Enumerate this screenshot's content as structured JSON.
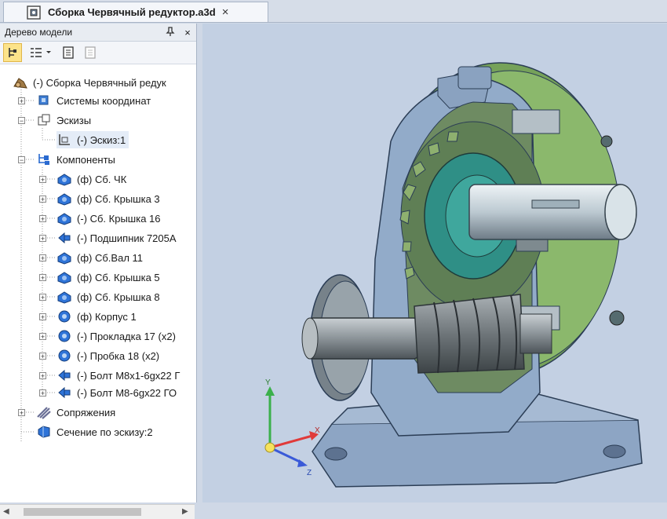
{
  "document_tab": {
    "title": "Сборка Червячный редуктор.a3d",
    "close": "×"
  },
  "model_tree_panel": {
    "title": "Дерево модели",
    "pin": "⌕",
    "close": "×",
    "items": [
      {
        "label": "(-) Сборка Червячный редук",
        "icon": "assembly-icon"
      },
      {
        "label": "Системы координат",
        "icon": "coordinate-systems-icon"
      },
      {
        "label": "Эскизы",
        "icon": "sketches-icon"
      },
      {
        "label": "(-) Эскиз:1",
        "icon": "sketch-icon"
      },
      {
        "label": "Компоненты",
        "icon": "components-icon"
      },
      {
        "label": "(ф) Сб. ЧК",
        "icon": "subassembly-icon"
      },
      {
        "label": "(ф) Сб. Крышка 3",
        "icon": "subassembly-icon"
      },
      {
        "label": "(-) Сб. Крышка 16",
        "icon": "subassembly-icon"
      },
      {
        "label": "(-) Подшипник 7205А",
        "icon": "standard-part-icon"
      },
      {
        "label": "(ф) Сб.Вал 11",
        "icon": "subassembly-icon"
      },
      {
        "label": "(ф) Сб. Крышка 5",
        "icon": "subassembly-icon"
      },
      {
        "label": "(ф) Сб. Крышка 8",
        "icon": "subassembly-icon"
      },
      {
        "label": "(ф) Корпус 1",
        "icon": "part-icon"
      },
      {
        "label": "(-) Прокладка 17 (x2)",
        "icon": "part-icon"
      },
      {
        "label": "(-) Пробка 18 (x2)",
        "icon": "part-icon"
      },
      {
        "label": "(-) Болт М8x1-6gx22 Г",
        "icon": "standard-part-icon"
      },
      {
        "label": "(-) Болт М8-6gx22 ГО",
        "icon": "standard-part-icon"
      },
      {
        "label": "Сопряжения",
        "icon": "mates-icon"
      },
      {
        "label": "Сечение по эскизу:2",
        "icon": "section-icon"
      }
    ]
  },
  "viewport": {
    "triad": {
      "x": "X",
      "y": "Y",
      "z": "Z"
    }
  },
  "colors": {
    "accent": "#fce38a",
    "body_blue": "#8ea6c3",
    "cover_green": "#78a45a",
    "shaft": "#c5d3da",
    "worm": "#7d8589",
    "teal": "#2f8f86",
    "background": "#c3d0e3"
  }
}
